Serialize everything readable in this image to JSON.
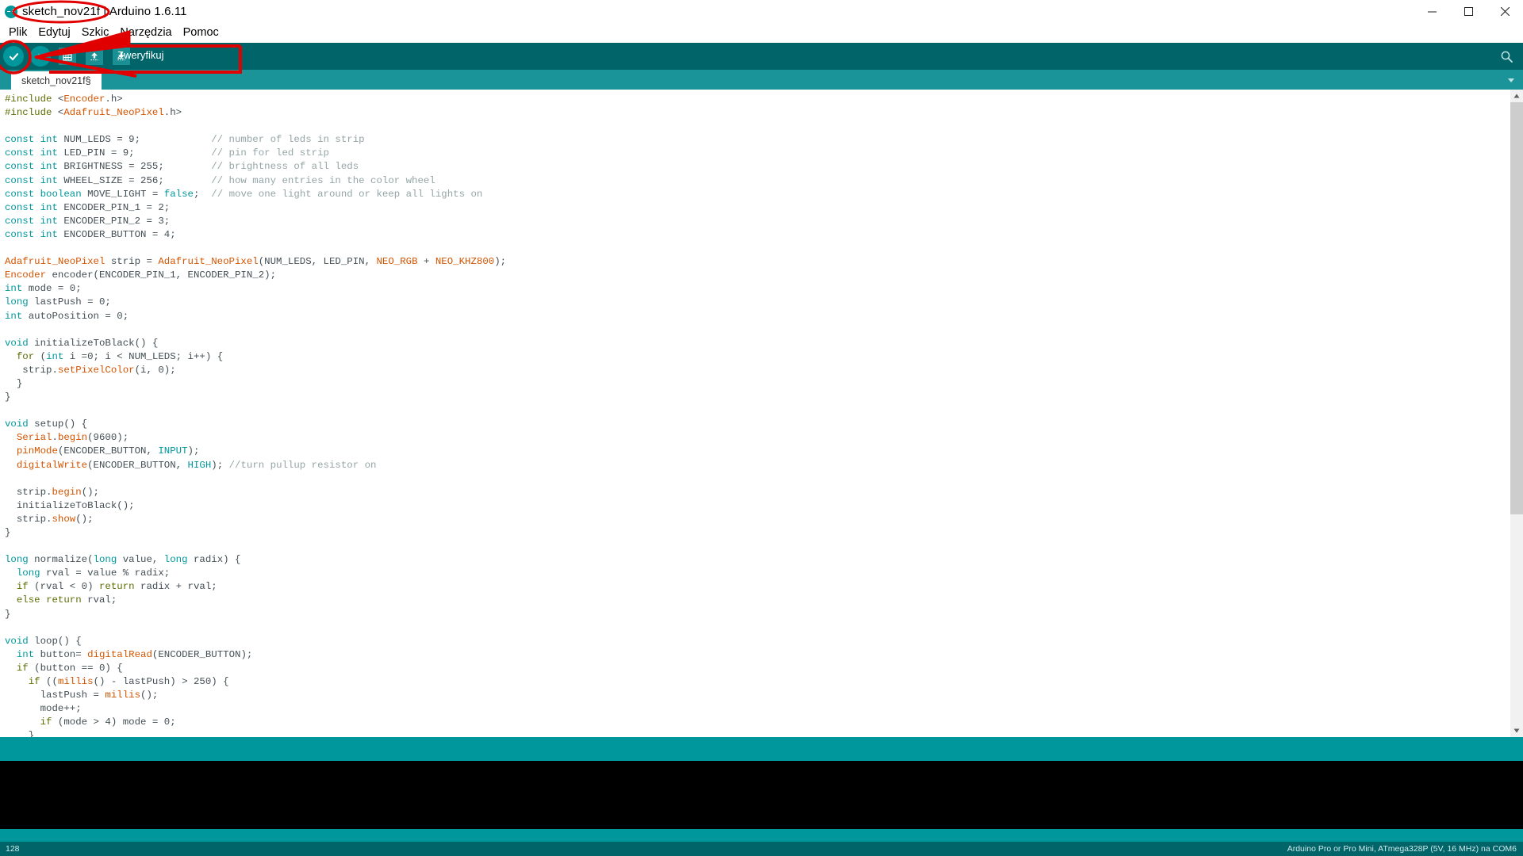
{
  "window": {
    "title": "sketch_nov21f | Arduino 1.6.11",
    "logo_name": "arduino-logo",
    "minimize": "—",
    "maximize": "☐",
    "close": "✕"
  },
  "menubar": {
    "items": [
      {
        "label": "Plik"
      },
      {
        "label": "Edytuj"
      },
      {
        "label": "Szkic"
      },
      {
        "label": "Narzędzia"
      },
      {
        "label": "Pomoc"
      }
    ]
  },
  "toolbar": {
    "verify_label": "Zweryfikuj",
    "buttons": [
      {
        "name": "verify-button",
        "icon": "check-icon"
      },
      {
        "name": "upload-button",
        "icon": "arrow-right-icon"
      },
      {
        "name": "new-button",
        "icon": "new-document-icon"
      },
      {
        "name": "open-button",
        "icon": "arrow-up-icon"
      },
      {
        "name": "save-button",
        "icon": "arrow-down-icon"
      }
    ],
    "serial_monitor_icon": "magnifier-icon"
  },
  "tabs": {
    "active": "sketch_nov21f§",
    "menu_icon": "chevron-down-icon"
  },
  "editor": {
    "lines": [
      [
        {
          "t": "#include ",
          "c": "pre"
        },
        {
          "t": "<",
          "c": "pl"
        },
        {
          "t": "Encoder",
          "c": "hdr"
        },
        {
          "t": ".h>",
          "c": "pl"
        }
      ],
      [
        {
          "t": "#include ",
          "c": "pre"
        },
        {
          "t": "<",
          "c": "pl"
        },
        {
          "t": "Adafruit_NeoPixel",
          "c": "hdr"
        },
        {
          "t": ".h>",
          "c": "pl"
        }
      ],
      [],
      [
        {
          "t": "const int",
          "c": "kw"
        },
        {
          "t": " NUM_LEDS = 9;            ",
          "c": "pl"
        },
        {
          "t": "// number of leds in strip",
          "c": "cmt"
        }
      ],
      [
        {
          "t": "const int",
          "c": "kw"
        },
        {
          "t": " LED_PIN = 9;             ",
          "c": "pl"
        },
        {
          "t": "// pin for led strip",
          "c": "cmt"
        }
      ],
      [
        {
          "t": "const int",
          "c": "kw"
        },
        {
          "t": " BRIGHTNESS = 255;        ",
          "c": "pl"
        },
        {
          "t": "// brightness of all leds",
          "c": "cmt"
        }
      ],
      [
        {
          "t": "const int",
          "c": "kw"
        },
        {
          "t": " WHEEL_SIZE = 256;        ",
          "c": "pl"
        },
        {
          "t": "// how many entries in the color wheel",
          "c": "cmt"
        }
      ],
      [
        {
          "t": "const boolean",
          "c": "kw"
        },
        {
          "t": " MOVE_LIGHT = ",
          "c": "pl"
        },
        {
          "t": "false",
          "c": "lit"
        },
        {
          "t": ";  ",
          "c": "pl"
        },
        {
          "t": "// move one light around or keep all lights on",
          "c": "cmt"
        }
      ],
      [
        {
          "t": "const int",
          "c": "kw"
        },
        {
          "t": " ENCODER_PIN_1 = 2;",
          "c": "pl"
        }
      ],
      [
        {
          "t": "const int",
          "c": "kw"
        },
        {
          "t": " ENCODER_PIN_2 = 3;",
          "c": "pl"
        }
      ],
      [
        {
          "t": "const int",
          "c": "kw"
        },
        {
          "t": " ENCODER_BUTTON = 4;",
          "c": "pl"
        }
      ],
      [],
      [
        {
          "t": "Adafruit_NeoPixel",
          "c": "fn"
        },
        {
          "t": " strip = ",
          "c": "pl"
        },
        {
          "t": "Adafruit_NeoPixel",
          "c": "fn"
        },
        {
          "t": "(NUM_LEDS, LED_PIN, ",
          "c": "pl"
        },
        {
          "t": "NEO_RGB",
          "c": "fn"
        },
        {
          "t": " + ",
          "c": "pl"
        },
        {
          "t": "NEO_KHZ800",
          "c": "fn"
        },
        {
          "t": ");",
          "c": "pl"
        }
      ],
      [
        {
          "t": "Encoder",
          "c": "fn"
        },
        {
          "t": " encoder(ENCODER_PIN_1, ENCODER_PIN_2);",
          "c": "pl"
        }
      ],
      [
        {
          "t": "int",
          "c": "kw"
        },
        {
          "t": " mode = 0;",
          "c": "pl"
        }
      ],
      [
        {
          "t": "long",
          "c": "kw"
        },
        {
          "t": " lastPush = 0;",
          "c": "pl"
        }
      ],
      [
        {
          "t": "int",
          "c": "kw"
        },
        {
          "t": " autoPosition = 0;",
          "c": "pl"
        }
      ],
      [],
      [
        {
          "t": "void",
          "c": "kw"
        },
        {
          "t": " initializeToBlack() {",
          "c": "pl"
        }
      ],
      [
        {
          "t": "  ",
          "c": "pl"
        },
        {
          "t": "for",
          "c": "kw2"
        },
        {
          "t": " (",
          "c": "pl"
        },
        {
          "t": "int",
          "c": "kw"
        },
        {
          "t": " i =0; i < NUM_LEDS; i++) {",
          "c": "pl"
        }
      ],
      [
        {
          "t": "   strip.",
          "c": "pl"
        },
        {
          "t": "setPixelColor",
          "c": "fn"
        },
        {
          "t": "(i, 0);",
          "c": "pl"
        }
      ],
      [
        {
          "t": "  }",
          "c": "pl"
        }
      ],
      [
        {
          "t": "}",
          "c": "pl"
        }
      ],
      [],
      [
        {
          "t": "void",
          "c": "kw"
        },
        {
          "t": " setup() {",
          "c": "pl"
        }
      ],
      [
        {
          "t": "  ",
          "c": "pl"
        },
        {
          "t": "Serial",
          "c": "fn"
        },
        {
          "t": ".",
          "c": "pl"
        },
        {
          "t": "begin",
          "c": "fn"
        },
        {
          "t": "(9600);",
          "c": "pl"
        }
      ],
      [
        {
          "t": "  ",
          "c": "pl"
        },
        {
          "t": "pinMode",
          "c": "fn"
        },
        {
          "t": "(ENCODER_BUTTON, ",
          "c": "pl"
        },
        {
          "t": "INPUT",
          "c": "lit"
        },
        {
          "t": ");",
          "c": "pl"
        }
      ],
      [
        {
          "t": "  ",
          "c": "pl"
        },
        {
          "t": "digitalWrite",
          "c": "fn"
        },
        {
          "t": "(ENCODER_BUTTON, ",
          "c": "pl"
        },
        {
          "t": "HIGH",
          "c": "lit"
        },
        {
          "t": "); ",
          "c": "pl"
        },
        {
          "t": "//turn pullup resistor on",
          "c": "cmt"
        }
      ],
      [],
      [
        {
          "t": "  strip.",
          "c": "pl"
        },
        {
          "t": "begin",
          "c": "fn"
        },
        {
          "t": "();",
          "c": "pl"
        }
      ],
      [
        {
          "t": "  initializeToBlack();",
          "c": "pl"
        }
      ],
      [
        {
          "t": "  strip.",
          "c": "pl"
        },
        {
          "t": "show",
          "c": "fn"
        },
        {
          "t": "();",
          "c": "pl"
        }
      ],
      [
        {
          "t": "}",
          "c": "pl"
        }
      ],
      [],
      [
        {
          "t": "long",
          "c": "kw"
        },
        {
          "t": " normalize(",
          "c": "pl"
        },
        {
          "t": "long",
          "c": "kw"
        },
        {
          "t": " value, ",
          "c": "pl"
        },
        {
          "t": "long",
          "c": "kw"
        },
        {
          "t": " radix) {",
          "c": "pl"
        }
      ],
      [
        {
          "t": "  ",
          "c": "pl"
        },
        {
          "t": "long",
          "c": "kw"
        },
        {
          "t": " rval = value % radix;",
          "c": "pl"
        }
      ],
      [
        {
          "t": "  ",
          "c": "pl"
        },
        {
          "t": "if",
          "c": "kw2"
        },
        {
          "t": " (rval < 0) ",
          "c": "pl"
        },
        {
          "t": "return",
          "c": "kw2"
        },
        {
          "t": " radix + rval;",
          "c": "pl"
        }
      ],
      [
        {
          "t": "  ",
          "c": "pl"
        },
        {
          "t": "else",
          "c": "kw2"
        },
        {
          "t": " ",
          "c": "pl"
        },
        {
          "t": "return",
          "c": "kw2"
        },
        {
          "t": " rval;",
          "c": "pl"
        }
      ],
      [
        {
          "t": "}",
          "c": "pl"
        }
      ],
      [],
      [
        {
          "t": "void",
          "c": "kw"
        },
        {
          "t": " loop() {",
          "c": "pl"
        }
      ],
      [
        {
          "t": "  ",
          "c": "pl"
        },
        {
          "t": "int",
          "c": "kw"
        },
        {
          "t": " button= ",
          "c": "pl"
        },
        {
          "t": "digitalRead",
          "c": "fn"
        },
        {
          "t": "(ENCODER_BUTTON);",
          "c": "pl"
        }
      ],
      [
        {
          "t": "  ",
          "c": "pl"
        },
        {
          "t": "if",
          "c": "kw2"
        },
        {
          "t": " (button == 0) {",
          "c": "pl"
        }
      ],
      [
        {
          "t": "    ",
          "c": "pl"
        },
        {
          "t": "if",
          "c": "kw2"
        },
        {
          "t": " ((",
          "c": "pl"
        },
        {
          "t": "millis",
          "c": "fn"
        },
        {
          "t": "() - lastPush) > 250) {",
          "c": "pl"
        }
      ],
      [
        {
          "t": "      lastPush = ",
          "c": "pl"
        },
        {
          "t": "millis",
          "c": "fn"
        },
        {
          "t": "();",
          "c": "pl"
        }
      ],
      [
        {
          "t": "      mode++;",
          "c": "pl"
        }
      ],
      [
        {
          "t": "      ",
          "c": "pl"
        },
        {
          "t": "if",
          "c": "kw2"
        },
        {
          "t": " (mode > 4) mode = 0;",
          "c": "pl"
        }
      ],
      [
        {
          "t": "    }",
          "c": "pl"
        }
      ]
    ]
  },
  "statusbar": {
    "line_number": "128",
    "board_info": "Arduino Pro or Pro Mini, ATmega328P (5V, 16 MHz) na COM6"
  },
  "annotations": {
    "color": "#e00000",
    "ellipse_title_name": "title-highlight-ellipse",
    "ellipse_verify_name": "verify-button-highlight-ellipse",
    "arrow_name": "pointer-arrow",
    "box_name": "tooltip-highlight-box"
  },
  "colors": {
    "teal_dark": "#006468",
    "teal": "#00979c",
    "teal_light": "#1a9499",
    "annotation_red": "#e00000"
  }
}
